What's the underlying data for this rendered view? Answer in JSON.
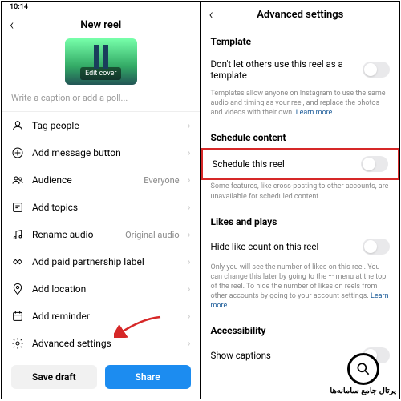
{
  "left": {
    "status_time": "10:14",
    "header_title": "New reel",
    "cover_label": "Edit cover",
    "caption_placeholder": "Write a caption or add a poll...",
    "rows": {
      "tag_people": "Tag people",
      "add_message": "Add message button",
      "audience": "Audience",
      "audience_val": "Everyone",
      "add_topics": "Add topics",
      "rename_audio": "Rename audio",
      "rename_audio_val": "Original audio",
      "paid_partnership": "Add paid partnership label",
      "add_location": "Add location",
      "add_reminder": "Add reminder",
      "advanced_settings": "Advanced settings"
    },
    "buttons": {
      "save_draft": "Save draft",
      "share": "Share"
    }
  },
  "right": {
    "header_title": "Advanced settings",
    "template": {
      "title": "Template",
      "opt": "Don't let others use this reel as a template",
      "desc": "Templates allow anyone on Instagram to use the same audio and timing as your reel, and replace the photos and videos with their own. ",
      "learn_more": "Learn more"
    },
    "schedule": {
      "title": "Schedule content",
      "opt": "Schedule this reel",
      "desc": "Some features, like cross-posting to other accounts, are unavailable for scheduled content."
    },
    "likes": {
      "title": "Likes and plays",
      "opt": "Hide like count on this reel",
      "desc": "Only you will see the number of likes on this reel. You can change this later by going to the ··· menu at the top of the reel. To hide the number of likes on reels from other accounts by going to your account settings. ",
      "learn_more": "Learn more"
    },
    "accessibility": {
      "title": "Accessibility",
      "opt": "Show captions"
    }
  },
  "watermark": "پرتال جامع سامانه‌ها"
}
